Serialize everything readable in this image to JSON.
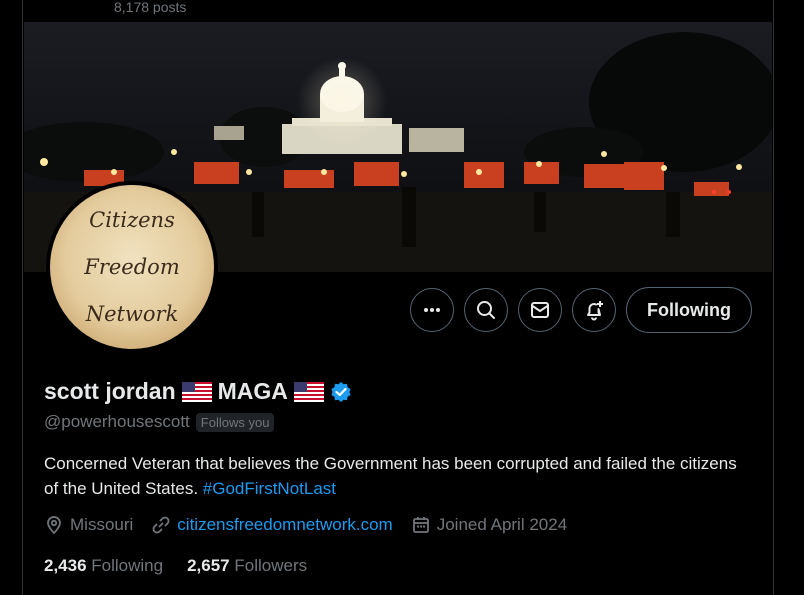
{
  "header": {
    "posts_count": "8,178 posts"
  },
  "avatar": {
    "line1": "Citizens",
    "line2": "Freedom",
    "line3": "Network"
  },
  "actions": {
    "follow_label": "Following"
  },
  "profile": {
    "display_name": "scott jordan",
    "name_suffix": "MAGA",
    "handle": "@powerhousescott",
    "follows_you": "Follows you",
    "bio_text": "Concerned Veteran that believes the Government has been corrupted and failed the citizens of the United States.",
    "bio_hashtag": "#GodFirstNotLast",
    "location": "Missouri",
    "website": "citizensfreedomnetwork.com",
    "joined": "Joined April 2024"
  },
  "stats": {
    "following_count": "2,436",
    "following_label": "Following",
    "followers_count": "2,657",
    "followers_label": "Followers"
  },
  "colors": {
    "background": "#000000",
    "text_primary": "#e7e9ea",
    "text_secondary": "#71767b",
    "accent": "#1d9bf0",
    "border": "#536471"
  },
  "icons": [
    "more-icon",
    "search-icon",
    "message-icon",
    "notification-bell-icon",
    "verified-badge-icon",
    "location-icon",
    "link-icon",
    "calendar-icon",
    "us-flag-icon"
  ]
}
